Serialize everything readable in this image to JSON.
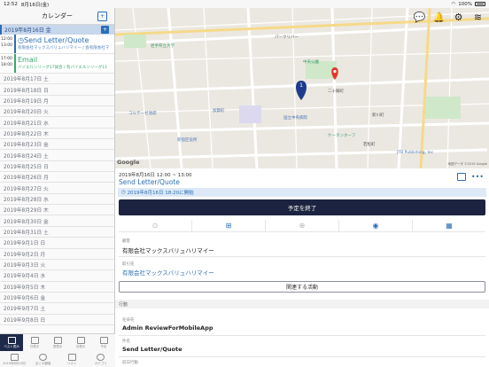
{
  "status": {
    "time": "12:52",
    "date": "8月16日(金)",
    "battery": "100%"
  },
  "left": {
    "title": "カレンダー",
    "selected_day": "2019年8月16日 金",
    "add_glyph": "+",
    "events": [
      {
        "start": "12:00",
        "end": "13:00",
        "name": "Send Letter/Quote",
        "sub": "有限会社マックスバリュハリマイー / 会有限会社マ",
        "color": "blue"
      },
      {
        "start": "17:00",
        "end": "18:00",
        "name": "Email",
        "sub": "バイエルンリーグ17試合 / 有バイエルンリーグ11",
        "color": "green"
      }
    ],
    "days": [
      "2019年8月17日 土",
      "2019年8月18日 日",
      "2019年8月19日 月",
      "2019年8月20日 火",
      "2019年8月21日 水",
      "2019年8月22日 木",
      "2019年8月23日 金",
      "2019年8月24日 土",
      "2019年8月25日 日",
      "2019年8月26日 月",
      "2019年8月27日 火",
      "2019年8月28日 水",
      "2019年8月29日 木",
      "2019年8月30日 金",
      "2019年8月31日 土",
      "2019年9月1日 日",
      "2019年9月2日 月",
      "2019年9月3日 火",
      "2019年9月4日 水",
      "2019年9月5日 木",
      "2019年9月6日 金",
      "2019年9月7日 土",
      "2019年9月8日 日"
    ],
    "tabs_top": [
      "ベスト表示",
      "日表示",
      "週表示",
      "月表示",
      "予定"
    ],
    "tabs_bottom": [
      "2019年8月16日",
      "近くの顧客",
      "リスト",
      "カテゴリ"
    ]
  },
  "map": {
    "google": "Google",
    "data_note": "地図データ ©2019 Google",
    "marker_number": "1",
    "labels": [
      {
        "text": "パークリバー"
      },
      {
        "text": "岩手県立大学"
      },
      {
        "text": "中央公園"
      },
      {
        "text": "二十騎町"
      },
      {
        "text": "国立中央病院"
      },
      {
        "text": "新宿区役所"
      },
      {
        "text": "ケータンホーフ"
      },
      {
        "text": "JTB Publishing, Inc"
      },
      {
        "text": "コルテーゼ池袋"
      },
      {
        "text": "加賀町"
      },
      {
        "text": "若松町"
      },
      {
        "text": "新川町"
      }
    ]
  },
  "detail": {
    "datetime": "2019年8月16日 12:00 ~ 13:00",
    "title": "Send Letter/Quote",
    "started": "2019年8月16日 18:20に開始",
    "end_label": "予定を終了",
    "client_label": "顧客",
    "client_value": "有限会社マックスバリュハリマイー",
    "account_label": "取引先",
    "account_value": "有限会社マックスバリュハリマイー",
    "related_label": "関連する活動",
    "section_label": "行動",
    "owner_label": "任命先",
    "owner_value": "Admin ReviewForMobileApp",
    "subject_label": "件名",
    "subject_value": "Send Letter/Quote",
    "next_label": "前日行動"
  }
}
